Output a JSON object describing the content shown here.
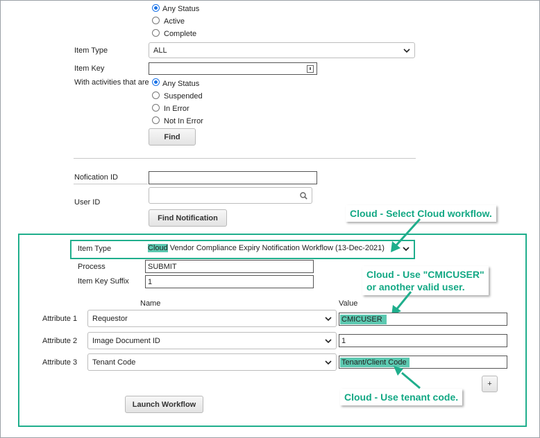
{
  "status_group": {
    "options": [
      "Any Status",
      "Active",
      "Complete"
    ],
    "selected": 0
  },
  "item_type": {
    "label": "Item Type",
    "value": "ALL"
  },
  "item_key": {
    "label": "Item Key",
    "value": ""
  },
  "activities": {
    "label": "With activities that are",
    "options": [
      "Any Status",
      "Suspended",
      "In Error",
      "Not In Error"
    ],
    "selected": 0
  },
  "find_button": "Find",
  "notification_id": {
    "label": "Nofication ID",
    "value": ""
  },
  "user_id": {
    "label": "User ID",
    "value": ""
  },
  "find_notification_button": "Find Notification",
  "workflow": {
    "item_type_label": "Item Type",
    "item_type_highlight": "Cloud",
    "item_type_rest": " Vendor Compliance Expiry Notification Workflow (13-Dec-2021)",
    "process_label": "Process",
    "process_value": "SUBMIT",
    "item_key_suffix_label": "Item Key Suffix",
    "item_key_suffix_value": "1",
    "name_header": "Name",
    "value_header": "Value",
    "attributes": [
      {
        "label": "Attribute 1",
        "name": "Requestor",
        "value": "CMICUSER"
      },
      {
        "label": "Attribute 2",
        "name": "Image Document ID",
        "value": "1"
      },
      {
        "label": "Attribute 3",
        "name": "Tenant Code",
        "value": "Tenant/Client Code"
      }
    ],
    "add_button": "+",
    "launch_button": "Launch Workflow"
  },
  "callouts": {
    "select_workflow": "Cloud - Select Cloud workflow.",
    "use_user_line1": "Cloud - Use \"CMICUSER\"",
    "use_user_line2": "or another valid user.",
    "tenant_code": "Cloud - Use tenant code."
  },
  "colors": {
    "accent": "#1fae8c",
    "highlight": "#5cc8b0",
    "radio": "#1a73e8"
  }
}
